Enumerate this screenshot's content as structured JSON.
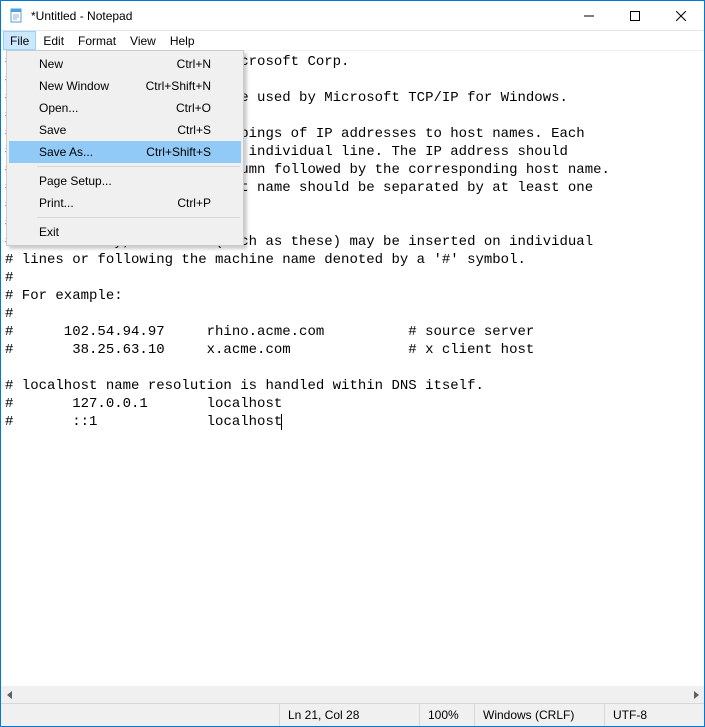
{
  "window": {
    "title": "*Untitled - Notepad"
  },
  "menubar": {
    "items": [
      "File",
      "Edit",
      "Format",
      "View",
      "Help"
    ],
    "open_index": 0
  },
  "file_menu": {
    "items": [
      {
        "label": "New",
        "shortcut": "Ctrl+N"
      },
      {
        "label": "New Window",
        "shortcut": "Ctrl+Shift+N"
      },
      {
        "label": "Open...",
        "shortcut": "Ctrl+O"
      },
      {
        "label": "Save",
        "shortcut": "Ctrl+S"
      },
      {
        "label": "Save As...",
        "shortcut": "Ctrl+Shift+S",
        "highlighted": true
      },
      {
        "sep": true
      },
      {
        "label": "Page Setup...",
        "shortcut": ""
      },
      {
        "label": "Print...",
        "shortcut": "Ctrl+P"
      },
      {
        "sep": true
      },
      {
        "label": "Exit",
        "shortcut": ""
      }
    ]
  },
  "editor": {
    "text": "# Copyright (c) 1993-2009 Microsoft Corp.\n#\n# This is a sample HOSTS file used by Microsoft TCP/IP for Windows.\n#\n# This file contains the mappings of IP addresses to host names. Each\n# entry should be kept on an individual line. The IP address should\n# be placed in the first column followed by the corresponding host name.\n# The IP address and the host name should be separated by at least one\n# space.\n#\n# Additionally, comments (such as these) may be inserted on individual\n# lines or following the machine name denoted by a '#' symbol.\n#\n# For example:\n#\n#      102.54.94.97     rhino.acme.com          # source server\n#       38.25.63.10     x.acme.com              # x client host\n\n# localhost name resolution is handled within DNS itself.\n#\t127.0.0.1       localhost\n#\t::1             localhost"
  },
  "statusbar": {
    "position": "Ln 21, Col 28",
    "zoom": "100%",
    "line_ending": "Windows (CRLF)",
    "encoding": "UTF-8"
  }
}
